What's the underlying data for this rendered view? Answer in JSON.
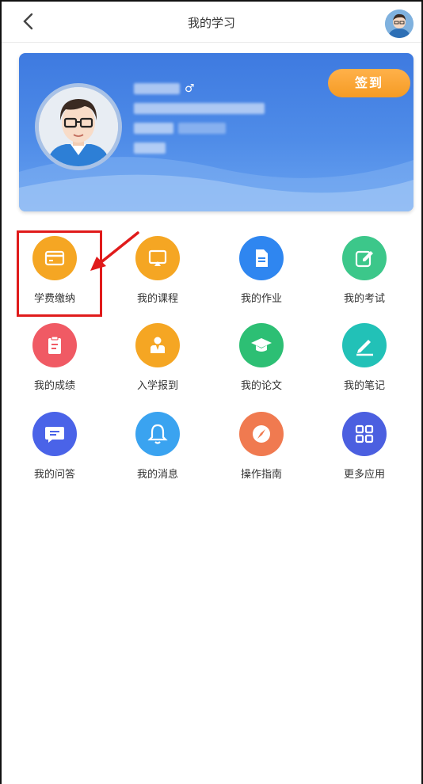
{
  "header": {
    "title": "我的学习"
  },
  "profile": {
    "signin_label": "签到"
  },
  "grid": [
    {
      "label": "学费缴纳",
      "icon": "card-icon",
      "color": "#f5a623"
    },
    {
      "label": "我的课程",
      "icon": "screen-icon",
      "color": "#f5a623"
    },
    {
      "label": "我的作业",
      "icon": "document-icon",
      "color": "#2f86f0"
    },
    {
      "label": "我的考试",
      "icon": "edit-icon",
      "color": "#3cc78a"
    },
    {
      "label": "我的成绩",
      "icon": "clipboard-icon",
      "color": "#f05a64"
    },
    {
      "label": "入学报到",
      "icon": "user-badge-icon",
      "color": "#f5a623"
    },
    {
      "label": "我的论文",
      "icon": "graduation-cap-icon",
      "color": "#2dbf74"
    },
    {
      "label": "我的笔记",
      "icon": "pen-icon",
      "color": "#22c1b7"
    },
    {
      "label": "我的问答",
      "icon": "chat-icon",
      "color": "#4a63e8"
    },
    {
      "label": "我的消息",
      "icon": "bell-icon",
      "color": "#3aa3f0"
    },
    {
      "label": "操作指南",
      "icon": "compass-icon",
      "color": "#f07a50"
    },
    {
      "label": "更多应用",
      "icon": "grid-icon",
      "color": "#4b5fe0"
    }
  ],
  "colors": {
    "accent": "#3e7ae0",
    "signin": "#f59b24",
    "highlight": "#e01b1b"
  }
}
